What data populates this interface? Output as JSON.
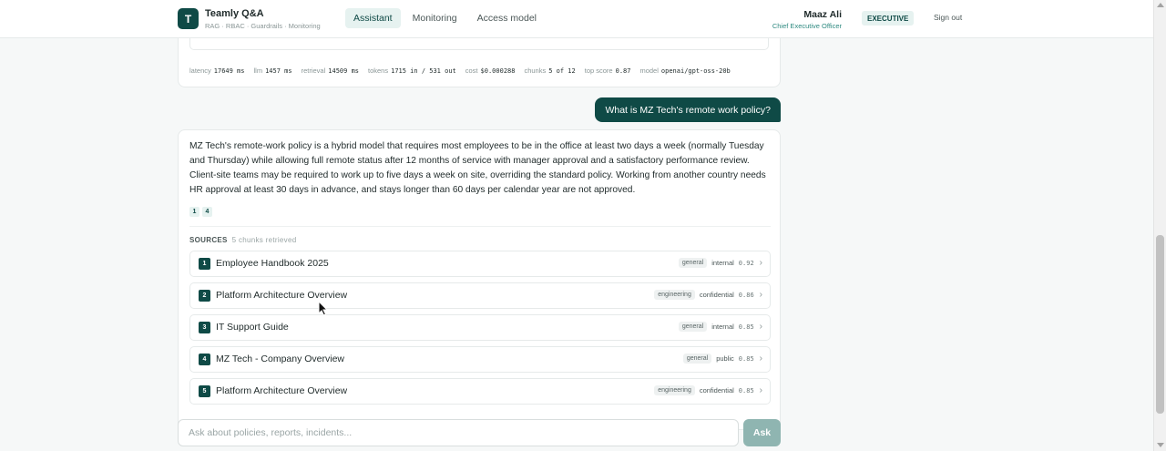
{
  "header": {
    "logo_letter": "T",
    "app_title": "Teamly Q&A",
    "app_subtitle": "RAG · RBAC · Guardrails · Monitoring",
    "nav": [
      {
        "label": "Assistant",
        "active": true
      },
      {
        "label": "Monitoring",
        "active": false
      },
      {
        "label": "Access model",
        "active": false
      }
    ],
    "user_name": "Maaz Ali",
    "user_role": "Chief Executive Officer",
    "role_badge": "EXECUTIVE",
    "sign_out": "Sign out"
  },
  "previous_message": {
    "metrics": [
      {
        "label": "latency",
        "value": "17649 ms"
      },
      {
        "label": "llm",
        "value": "1457 ms"
      },
      {
        "label": "retrieval",
        "value": "14509 ms"
      },
      {
        "label": "tokens",
        "value": "1715 in / 531 out"
      },
      {
        "label": "cost",
        "value": "$0.000288"
      },
      {
        "label": "chunks",
        "value": "5 of 12"
      },
      {
        "label": "top score",
        "value": "0.87"
      },
      {
        "label": "model",
        "value": "openai/gpt-oss-20b"
      }
    ]
  },
  "user_message": "What is MZ Tech's remote work policy?",
  "answer": {
    "text": "MZ Tech's remote-work policy is a hybrid model that requires most employees to be in the office at least two days a week (normally Tuesday and Thursday) while allowing full remote status after 12 months of service with manager approval and a satisfactory performance review. Client-site teams may be required to work up to five days a week on site, overriding the standard policy. Working from another country needs HR approval at least 30 days in advance, and stays longer than 60 days per calendar year are not approved.",
    "citations": [
      "1",
      "4"
    ],
    "sources_label": "SOURCES",
    "sources_count": "5 chunks retrieved",
    "sources": [
      {
        "num": "1",
        "title": "Employee Handbook 2025",
        "tag": "general",
        "access": "internal",
        "score": "0.92"
      },
      {
        "num": "2",
        "title": "Platform Architecture Overview",
        "tag": "engineering",
        "access": "confidential",
        "score": "0.86"
      },
      {
        "num": "3",
        "title": "IT Support Guide",
        "tag": "general",
        "access": "internal",
        "score": "0.85"
      },
      {
        "num": "4",
        "title": "MZ Tech - Company Overview",
        "tag": "general",
        "access": "public",
        "score": "0.85"
      },
      {
        "num": "5",
        "title": "Platform Architecture Overview",
        "tag": "engineering",
        "access": "confidential",
        "score": "0.85"
      }
    ]
  },
  "composer": {
    "placeholder": "Ask about policies, reports, incidents...",
    "value": "",
    "ask_label": "Ask"
  },
  "colors": {
    "brand": "#0f4a46",
    "accent_soft": "#e6f2f0",
    "ask_disabled": "#8fb5b1",
    "background": "#f6f8f8"
  }
}
